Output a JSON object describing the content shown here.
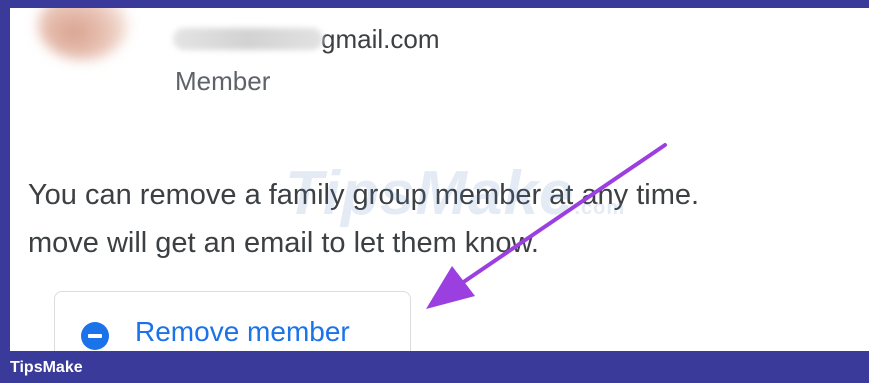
{
  "member": {
    "email_visible": "gmail.com",
    "role": "Member"
  },
  "description": {
    "line1": "You can remove a family group member at any time.",
    "line2": "move will get an email to let them know."
  },
  "remove_button": {
    "label": "Remove member",
    "icon": "minus-circle-icon"
  },
  "watermark": {
    "brand": "TipsMake",
    "suffix": ".com"
  },
  "footer": {
    "brand": "TipsMake"
  },
  "colors": {
    "accent": "#1a73e8",
    "arrow": "#9b3fe0",
    "frame": "#3a3a9a"
  }
}
